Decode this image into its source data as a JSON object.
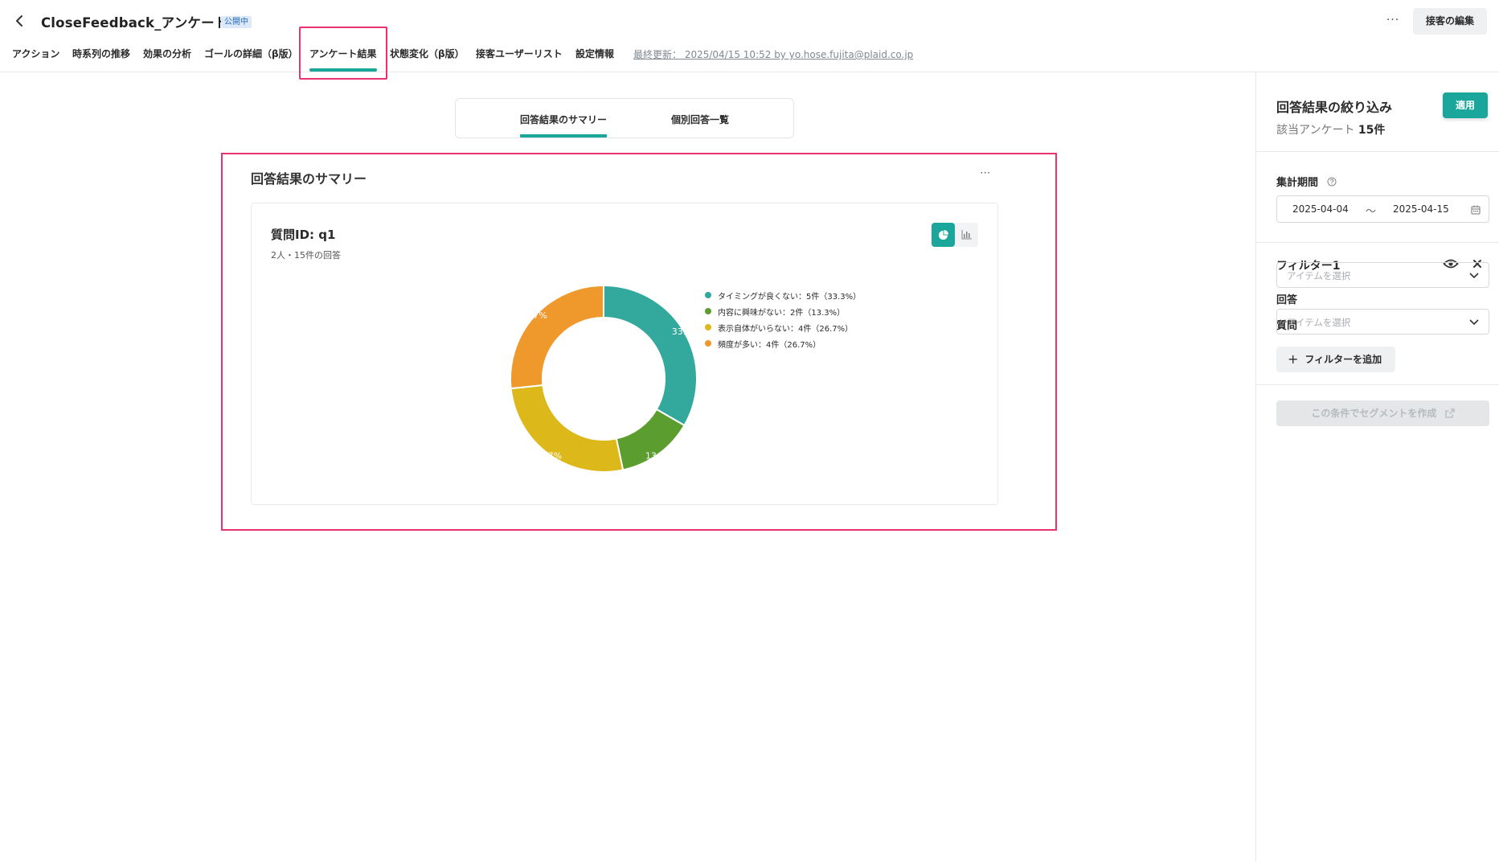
{
  "header": {
    "title": "CloseFeedback_アンケート",
    "status": "公開中",
    "more_label": "···",
    "edit_label": "接客の編集",
    "last_updated": "最終更新： 2025/04/15 10:52 by yo.hose.fujita@plaid.co.jp"
  },
  "nav": {
    "tabs": [
      {
        "label": "アクション"
      },
      {
        "label": "時系列の推移"
      },
      {
        "label": "効果の分析"
      },
      {
        "label": "ゴールの詳細（β版）"
      },
      {
        "label": "アンケート結果",
        "active": true
      },
      {
        "label": "状態変化（β版）"
      },
      {
        "label": "接客ユーザーリスト"
      },
      {
        "label": "設定情報"
      }
    ]
  },
  "segment_tabs": [
    {
      "label": "回答結果のサマリー",
      "active": true
    },
    {
      "label": "個別回答一覧"
    }
  ],
  "summary": {
    "title": "回答結果のサマリー",
    "more_label": "···",
    "question_title": "質問ID: q1",
    "question_sub": "2人・15件の回答"
  },
  "chart_data": {
    "type": "pie",
    "donut": true,
    "slices": [
      {
        "label": "タイミングが良くない",
        "count": 5,
        "percent": 33.3,
        "color": "#33a99d",
        "legend": "タイミングが良くない：5件（33.3%）",
        "data_label": "33.3%"
      },
      {
        "label": "内容に興味がない",
        "count": 2,
        "percent": 13.3,
        "color": "#5b9e2f",
        "legend": "内容に興味がない：2件（13.3%）",
        "data_label": "13.3%"
      },
      {
        "label": "表示自体がいらない",
        "count": 4,
        "percent": 26.7,
        "color": "#dcb81b",
        "legend": "表示自体がいらない：4件（26.7%）",
        "data_label": "26.7%"
      },
      {
        "label": "頻度が多い",
        "count": 4,
        "percent": 26.7,
        "color": "#ef982b",
        "legend": "頻度が多い：4件（26.7%）",
        "data_label": "26.7%"
      }
    ],
    "legend_position": "right"
  },
  "sidebar": {
    "title": "回答結果の絞り込み",
    "apply_label": "適用",
    "count_prefix": "該当アンケート",
    "count_value": "15件",
    "period_label": "集計期間",
    "date_from": "2025-04-04",
    "date_sep": "～",
    "date_to": "2025-04-15",
    "filter_title": "フィルター1",
    "question_label": "質問",
    "question_placeholder": "アイテムを選択",
    "answer_label": "回答",
    "answer_placeholder": "アイテムを選択",
    "add_filter_label": "フィルターを追加",
    "segment_btn_label": "この条件でセグメントを作成"
  },
  "colors": {
    "accent": "#1aa69b",
    "highlight": "#e8336f"
  }
}
